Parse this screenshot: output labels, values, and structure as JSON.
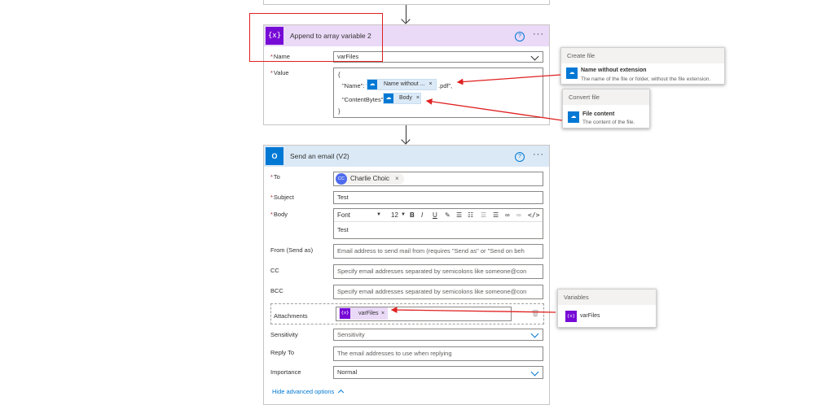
{
  "colors": {
    "accent": "#0078d4",
    "variable": "#770bd6",
    "outlook": "#0078d4",
    "highlight": "#e02020"
  },
  "append": {
    "title": "Append to array variable 2",
    "name_label": "Name",
    "name_value": "varFiles",
    "value_label": "Value",
    "json_open": "{",
    "json_name_key": "\"Name\": \"",
    "json_name_token": "Name without ...",
    "json_name_suffix": ".pdf\",",
    "json_bytes_key": "\"ContentBytes\":",
    "json_bytes_token": "Body",
    "json_close": "}",
    "icon": "variable-icon",
    "help": "?",
    "more": "···",
    "token_remove": "×"
  },
  "email": {
    "title": "Send an email (V2)",
    "icon": "outlook-icon",
    "to_label": "To",
    "to_initials": "CC",
    "to_value": "Charlie Choic",
    "subject_label": "Subject",
    "subject_value": "Test",
    "body_label": "Body",
    "font_value": "Font",
    "size_value": "12",
    "body_value": "Test",
    "from_label": "From (Send as)",
    "from_placeholder": "Email address to send mail from (requires \"Send as\" or \"Send on beh",
    "cc_label": "CC",
    "cc_placeholder": "Specify email addresses separated by semicolons like someone@con",
    "bcc_label": "BCC",
    "bcc_placeholder": "Specify email addresses separated by semicolons like someone@con",
    "attachments_label": "Attachments",
    "attachments_token": "varFiles",
    "sensitivity_label": "Sensitivity",
    "sensitivity_value": "Sensitivity",
    "replyto_label": "Reply To",
    "replyto_placeholder": "The email addresses to use when replying",
    "importance_label": "Importance",
    "importance_value": "Normal",
    "advanced_link": "Hide advanced options"
  },
  "popups": {
    "create": {
      "header": "Create file",
      "title": "Name without extension",
      "desc": "The name of the file or folder, without the file extension."
    },
    "convert": {
      "header": "Convert file",
      "title": "File content",
      "desc": "The content of the file."
    },
    "variables": {
      "header": "Variables",
      "title": "varFiles"
    }
  }
}
